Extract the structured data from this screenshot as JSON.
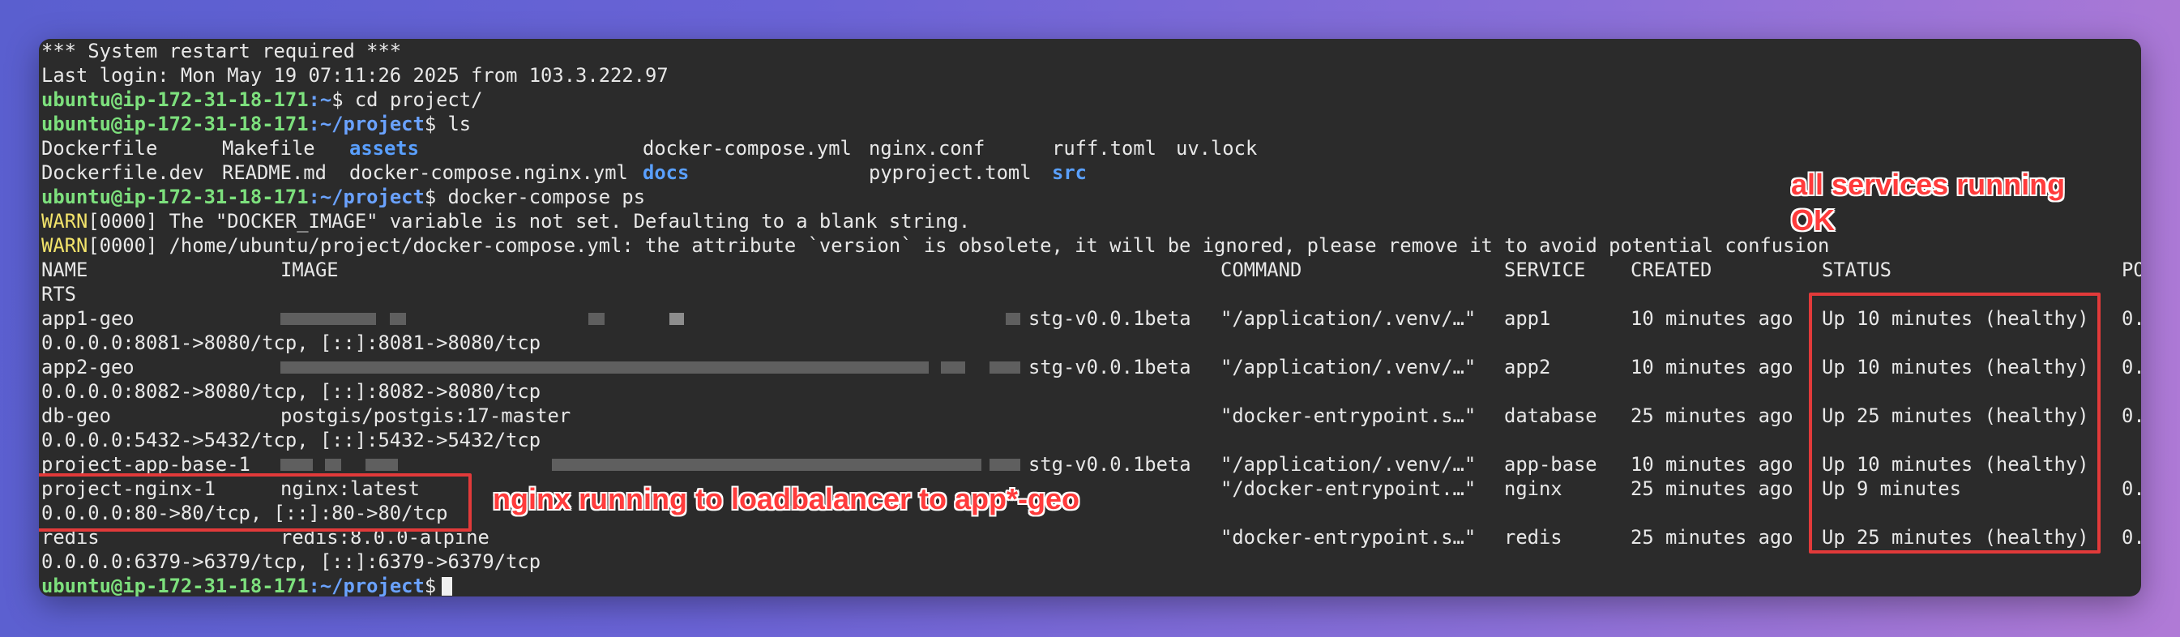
{
  "terminal": {
    "motd": "*** System restart required ***",
    "last_login": "Last login: Mon May 19 07:11:26 2025 from 103.3.222.97",
    "prompt_user": "ubuntu@ip-172-31-18-171",
    "prompt_home": ":~",
    "prompt_project": ":~/project",
    "prompt_dollar": "$",
    "cmd_cd": " cd project/",
    "cmd_ls": " ls",
    "cmd_ps": " docker-compose ps",
    "ls_files": {
      "r1": [
        "Dockerfile",
        "Makefile",
        "assets",
        "docker-compose.yml",
        "nginx.conf",
        "ruff.toml",
        "uv.lock"
      ],
      "r2": [
        "Dockerfile.dev",
        "README.md",
        "docker-compose.nginx.yml",
        "docs",
        "pyproject.toml",
        "src"
      ]
    },
    "warn_label": "WARN",
    "warn1": "[0000] The \"DOCKER_IMAGE\" variable is not set. Defaulting to a blank string.",
    "warn2": "[0000] /home/ubuntu/project/docker-compose.yml: the attribute `version` is obsolete, it will be ignored, please remove it to avoid potential confusion",
    "headers": {
      "name": "NAME",
      "image": "IMAGE",
      "command": "COMMAND",
      "service": "SERVICE",
      "created": "CREATED",
      "status": "STATUS",
      "ports": "PO",
      "ports_wrap": "RTS"
    },
    "rows": [
      {
        "name": "app1-geo",
        "image": "stg-v0.0.1beta",
        "command": "\"/application/.venv/…\"",
        "service": "app1",
        "created": "10 minutes ago",
        "status": "Up 10 minutes (healthy)",
        "ports_cut": "0.",
        "ports": "0.0.0.0:8081->8080/tcp, [::]:8081->8080/tcp"
      },
      {
        "name": "app2-geo",
        "image": "stg-v0.0.1beta",
        "command": "\"/application/.venv/…\"",
        "service": "app2",
        "created": "10 minutes ago",
        "status": "Up 10 minutes (healthy)",
        "ports_cut": "0.",
        "ports": "0.0.0.0:8082->8080/tcp, [::]:8082->8080/tcp"
      },
      {
        "name": "db-geo",
        "image": "postgis/postgis:17-master",
        "command": "\"docker-entrypoint.s…\"",
        "service": "database",
        "created": "25 minutes ago",
        "status": "Up 25 minutes (healthy)",
        "ports_cut": "0.",
        "ports": "0.0.0.0:5432->5432/tcp, [::]:5432->5432/tcp"
      },
      {
        "name": "project-app-base-1",
        "image": "stg-v0.0.1beta",
        "command": "\"/application/.venv/…\"",
        "service": "app-base",
        "created": "10 minutes ago",
        "status": "Up 10 minutes (healthy)",
        "ports_cut": "",
        "ports": ""
      },
      {
        "name": "project-nginx-1",
        "image": "nginx:latest",
        "command": "\"/docker-entrypoint.…\"",
        "service": "nginx",
        "created": "25 minutes ago",
        "status": "Up 9 minutes",
        "ports_cut": "0.",
        "ports": "0.0.0.0:80->80/tcp, [::]:80->80/tcp"
      },
      {
        "name": "redis",
        "image": "redis:8.0.0-alpine",
        "command": "\"docker-entrypoint.s…\"",
        "service": "redis",
        "created": "25 minutes ago",
        "status": "Up 25 minutes (healthy)",
        "ports_cut": "0.",
        "ports": "0.0.0.0:6379->6379/tcp, [::]:6379->6379/tcp"
      }
    ]
  },
  "annotations": {
    "status_note": "all services running\nOK",
    "nginx_note": "nginx running to loadbalancer to app*-geo"
  },
  "colors": {
    "prompt": "#7de07d",
    "path": "#6aa2ff",
    "warn": "#f2e36b",
    "annotation": "#e23a3a",
    "terminal_bg": "#2b2b2b"
  }
}
